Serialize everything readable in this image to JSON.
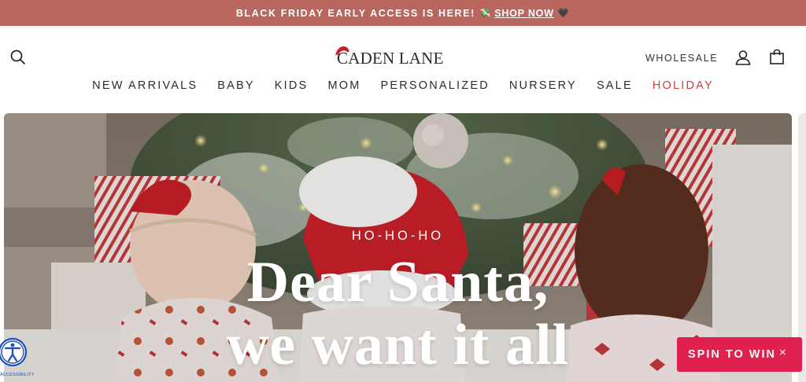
{
  "promo": {
    "text": "BLACK FRIDAY EARLY ACCESS IS HERE!",
    "emoji_before": "💸",
    "link": "SHOP NOW",
    "emoji_after": "🖤"
  },
  "header": {
    "logo": "CADEN LANE",
    "wholesale": "WHOLESALE"
  },
  "nav": {
    "items": [
      "NEW ARRIVALS",
      "BABY",
      "KIDS",
      "MOM",
      "PERSONALIZED",
      "NURSERY",
      "SALE",
      "HOLIDAY"
    ]
  },
  "hero": {
    "eyebrow": "HO-HO-HO",
    "title_line1": "Dear Santa,",
    "title_line2": "we want it all"
  },
  "widgets": {
    "spin": "SPIN TO WIN",
    "spin_close": "×",
    "accessibility_label": "ACCESSIBILITY"
  },
  "colors": {
    "promo_bg": "#b9675e",
    "holiday": "#d33b3b",
    "spin_bg": "#e0214f",
    "accessibility": "#1c4fb3"
  }
}
